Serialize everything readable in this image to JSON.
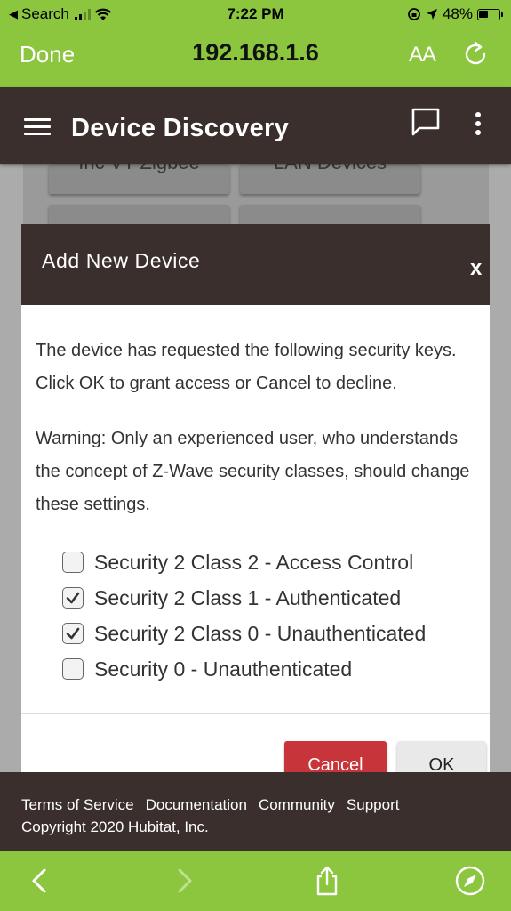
{
  "status_bar": {
    "back_app": "Search",
    "time": "7:22 PM",
    "battery": "48%"
  },
  "browser": {
    "done_label": "Done",
    "url": "192.168.1.6",
    "text_size_label": "AA"
  },
  "app_header": {
    "title": "Device Discovery"
  },
  "background_tiles": {
    "tile1": "Inc VT Zigbee",
    "tile2": "LAN Devices"
  },
  "modal": {
    "title": "Add New Device",
    "close_label": "x",
    "paragraph1": "The device has requested the following security keys. Click OK to grant access or Cancel to decline.",
    "paragraph2": "Warning: Only an experienced user, who understands the concept of Z-Wave security classes, should change these settings.",
    "options": [
      {
        "label": "Security 2 Class 2 - Access Control",
        "checked": false
      },
      {
        "label": "Security 2 Class 1 - Authenticated",
        "checked": true
      },
      {
        "label": "Security 2 Class 0 - Unauthenticated",
        "checked": true
      },
      {
        "label": "Security 0 - Unauthenticated",
        "checked": false
      }
    ],
    "cancel_label": "Cancel",
    "ok_label": "OK"
  },
  "footer": {
    "links": [
      "Terms of Service",
      "Documentation",
      "Community",
      "Support"
    ],
    "copyright": "Copyright 2020 Hubitat, Inc."
  },
  "colors": {
    "brand_green": "#8cc63f",
    "header_brown": "#3a2f2c",
    "cancel_red": "#c7343a"
  }
}
